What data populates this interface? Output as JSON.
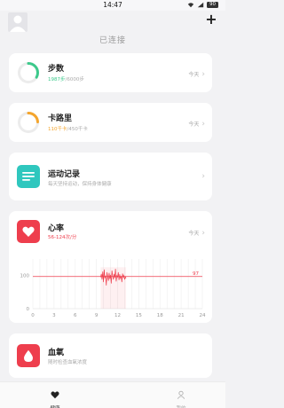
{
  "status_bar": {
    "time": "14:47",
    "battery": "90"
  },
  "header": {
    "connection_status": "已连接"
  },
  "cards": {
    "steps": {
      "title": "步数",
      "value": "1987步",
      "goal": "/6000步",
      "date": "今天",
      "progress": 0.33,
      "accent": "#3cc98b"
    },
    "calories": {
      "title": "卡路里",
      "value": "110千卡",
      "goal": "/450千卡",
      "date": "今天",
      "progress": 0.24,
      "accent": "#f4a52c"
    },
    "exercise": {
      "title": "运动记录",
      "subtitle": "每天坚持运动，保持身体健康",
      "icon": "list-icon",
      "accent": "#2fc7be"
    },
    "heart_rate": {
      "title": "心率",
      "range": "56-124次/分",
      "date": "今天",
      "icon": "heart-icon",
      "accent": "#ee3e4d"
    },
    "blood_oxygen": {
      "title": "血氧",
      "subtitle": "随时检查血氧浓度",
      "icon": "drop-icon",
      "accent": "#ee3e4d"
    }
  },
  "chart_data": {
    "type": "line",
    "x_ticks": [
      "0",
      "3",
      "6",
      "9",
      "12",
      "15",
      "18",
      "21",
      "24"
    ],
    "y_ticks": [
      "0",
      "100"
    ],
    "xlim": [
      0,
      24
    ],
    "ylim": [
      0,
      150
    ],
    "reference_line": {
      "value": 97,
      "label": "97",
      "color": "#ee3e4d"
    },
    "series": [
      {
        "color": "#ee3e4d",
        "x": [
          9.6,
          9.7,
          9.8,
          9.9,
          10.0,
          10.1,
          10.2,
          10.3,
          10.4,
          10.5,
          10.6,
          10.7,
          10.8,
          10.9,
          11.0,
          11.1,
          11.2,
          11.3,
          11.4,
          11.5,
          11.6,
          11.7,
          11.8,
          11.9,
          12.0,
          12.1,
          12.2,
          12.3,
          12.4,
          12.5,
          12.6,
          12.7,
          12.8,
          12.9,
          13.0,
          13.1,
          13.2
        ],
        "y": [
          95,
          105,
          88,
          112,
          80,
          118,
          92,
          100,
          70,
          110,
          96,
          84,
          108,
          90,
          102,
          76,
          115,
          98,
          88,
          105,
          93,
          120,
          82,
          100,
          95,
          110,
          86,
          104,
          92,
          98,
          80,
          106,
          94,
          100,
          88,
          96,
          92
        ]
      }
    ]
  },
  "bottom_nav": {
    "items": [
      {
        "label": "健康",
        "icon": "heart-icon",
        "active": true
      },
      {
        "label": "我的",
        "icon": "person-icon",
        "active": false
      }
    ]
  }
}
